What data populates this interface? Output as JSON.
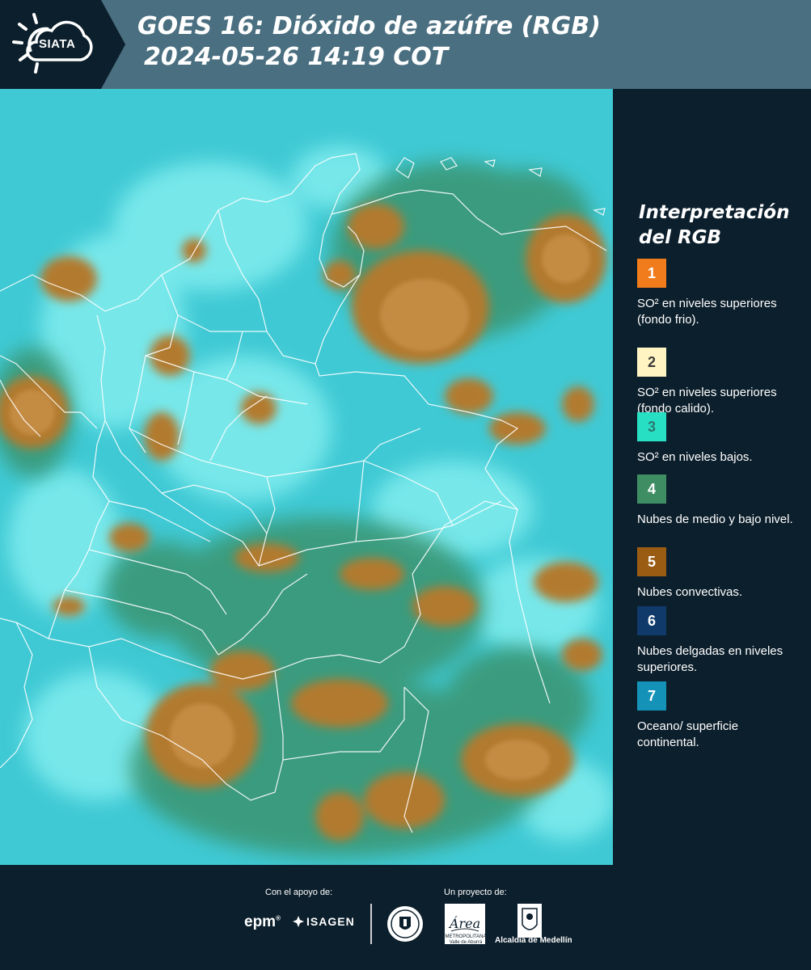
{
  "header": {
    "logo_text": "SIATA",
    "title_line1": "GOES 16: Dióxido de azúfre (RGB)",
    "title_line2": "2024-05-26 14:19 COT",
    "background": "#4a6f80"
  },
  "legend": {
    "title_line1": "Interpretación",
    "title_line2": "del RGB",
    "items": [
      {
        "number": "1",
        "label": "SO² en niveles superiores (fondo frio).",
        "color": "#f07c1c",
        "number_color": "#ffffff"
      },
      {
        "number": "2",
        "label": "SO² en niveles superiores (fondo calido).",
        "color": "#fff4c2",
        "number_color": "#3a3a3a"
      },
      {
        "number": "3",
        "label": "SO² en niveles bajos.",
        "color": "#27e0c4",
        "number_color": "#2a7a70"
      },
      {
        "number": "4",
        "label": "Nubes de medio y bajo nivel.",
        "color": "#3f8e63",
        "number_color": "#ffffff"
      },
      {
        "number": "5",
        "label": "Nubes convectivas.",
        "color": "#9a5b12",
        "number_color": "#ffffff"
      },
      {
        "number": "6",
        "label": "Nubes delgadas en niveles superiores.",
        "color": "#0f3a6a",
        "number_color": "#ffffff"
      },
      {
        "number": "7",
        "label": "Oceano/ superficie continental.",
        "color": "#1592b8",
        "number_color": "#ffffff"
      }
    ]
  },
  "footer": {
    "support_label": "Con el apoyo de:",
    "project_label": "Un proyecto de:",
    "sponsor_1": "epm",
    "sponsor_2": "ISAGEN",
    "partner_area": "Área",
    "partner_area_sub": "METROPOLITANA Valle de Aburrá",
    "partner_medellin": "Alcaldía de Medellín"
  },
  "map": {
    "palette": {
      "background": "#3fc9d4",
      "low_so2": "#7ff0f0",
      "midlevel": "#3d9a74",
      "convective": "#b07a2c",
      "border": "#ffffff"
    }
  }
}
